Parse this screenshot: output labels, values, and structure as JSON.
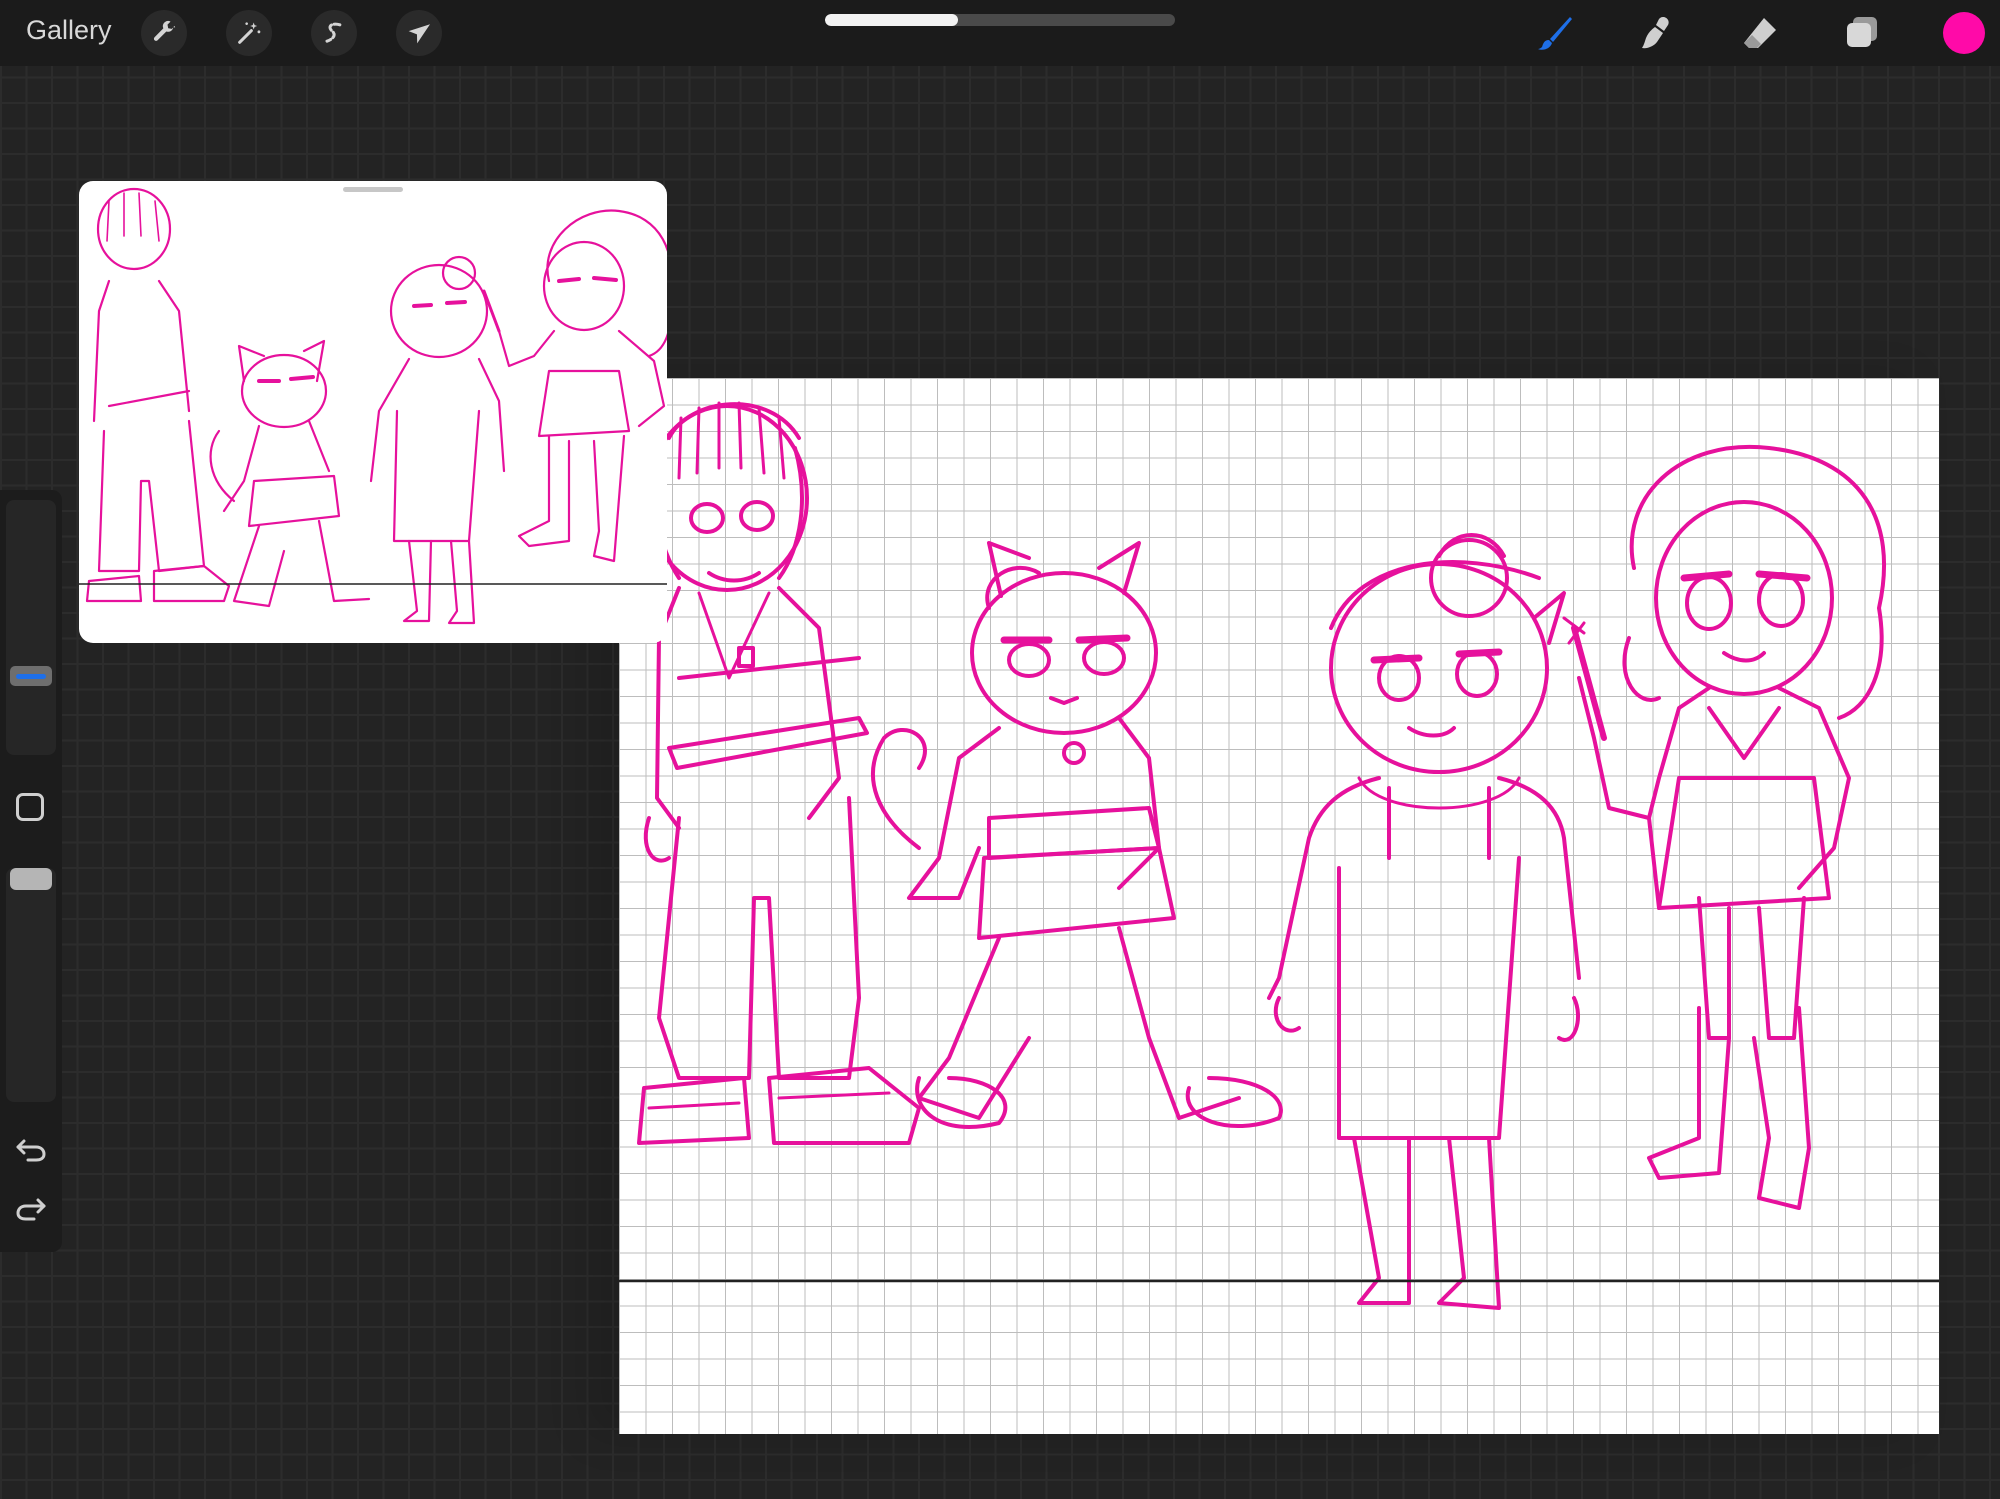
{
  "toolbar": {
    "gallery_label": "Gallery",
    "left_tools": [
      {
        "icon": "wrench-icon",
        "name": "actions"
      },
      {
        "icon": "magic-wand-icon",
        "name": "adjustments"
      },
      {
        "icon": "selection-s-icon",
        "name": "selection"
      },
      {
        "icon": "arrow-cursor-icon",
        "name": "transform"
      }
    ],
    "progress_fraction": 0.38,
    "right_tools": [
      {
        "icon": "brush-icon",
        "name": "paint",
        "active": true
      },
      {
        "icon": "smudge-icon",
        "name": "smudge",
        "active": false
      },
      {
        "icon": "eraser-icon",
        "name": "eraser",
        "active": false
      },
      {
        "icon": "layers-icon",
        "name": "layers",
        "active": false
      }
    ],
    "current_color": "#ff0aa8"
  },
  "sidebar": {
    "brush_size_icon": "size-slider",
    "modify_icon": "square-icon",
    "undo_icon": "undo-icon",
    "redo_icon": "redo-icon",
    "accent_color": "#1e6fe8"
  },
  "canvas": {
    "line_color": "#e6119c",
    "grid_color": "#bdbdbd",
    "characters": [
      "dreadlocks-guy",
      "cat-girl",
      "bun-lady",
      "curly-girl"
    ]
  },
  "reference": {
    "handle_icon": "drag-handle"
  }
}
